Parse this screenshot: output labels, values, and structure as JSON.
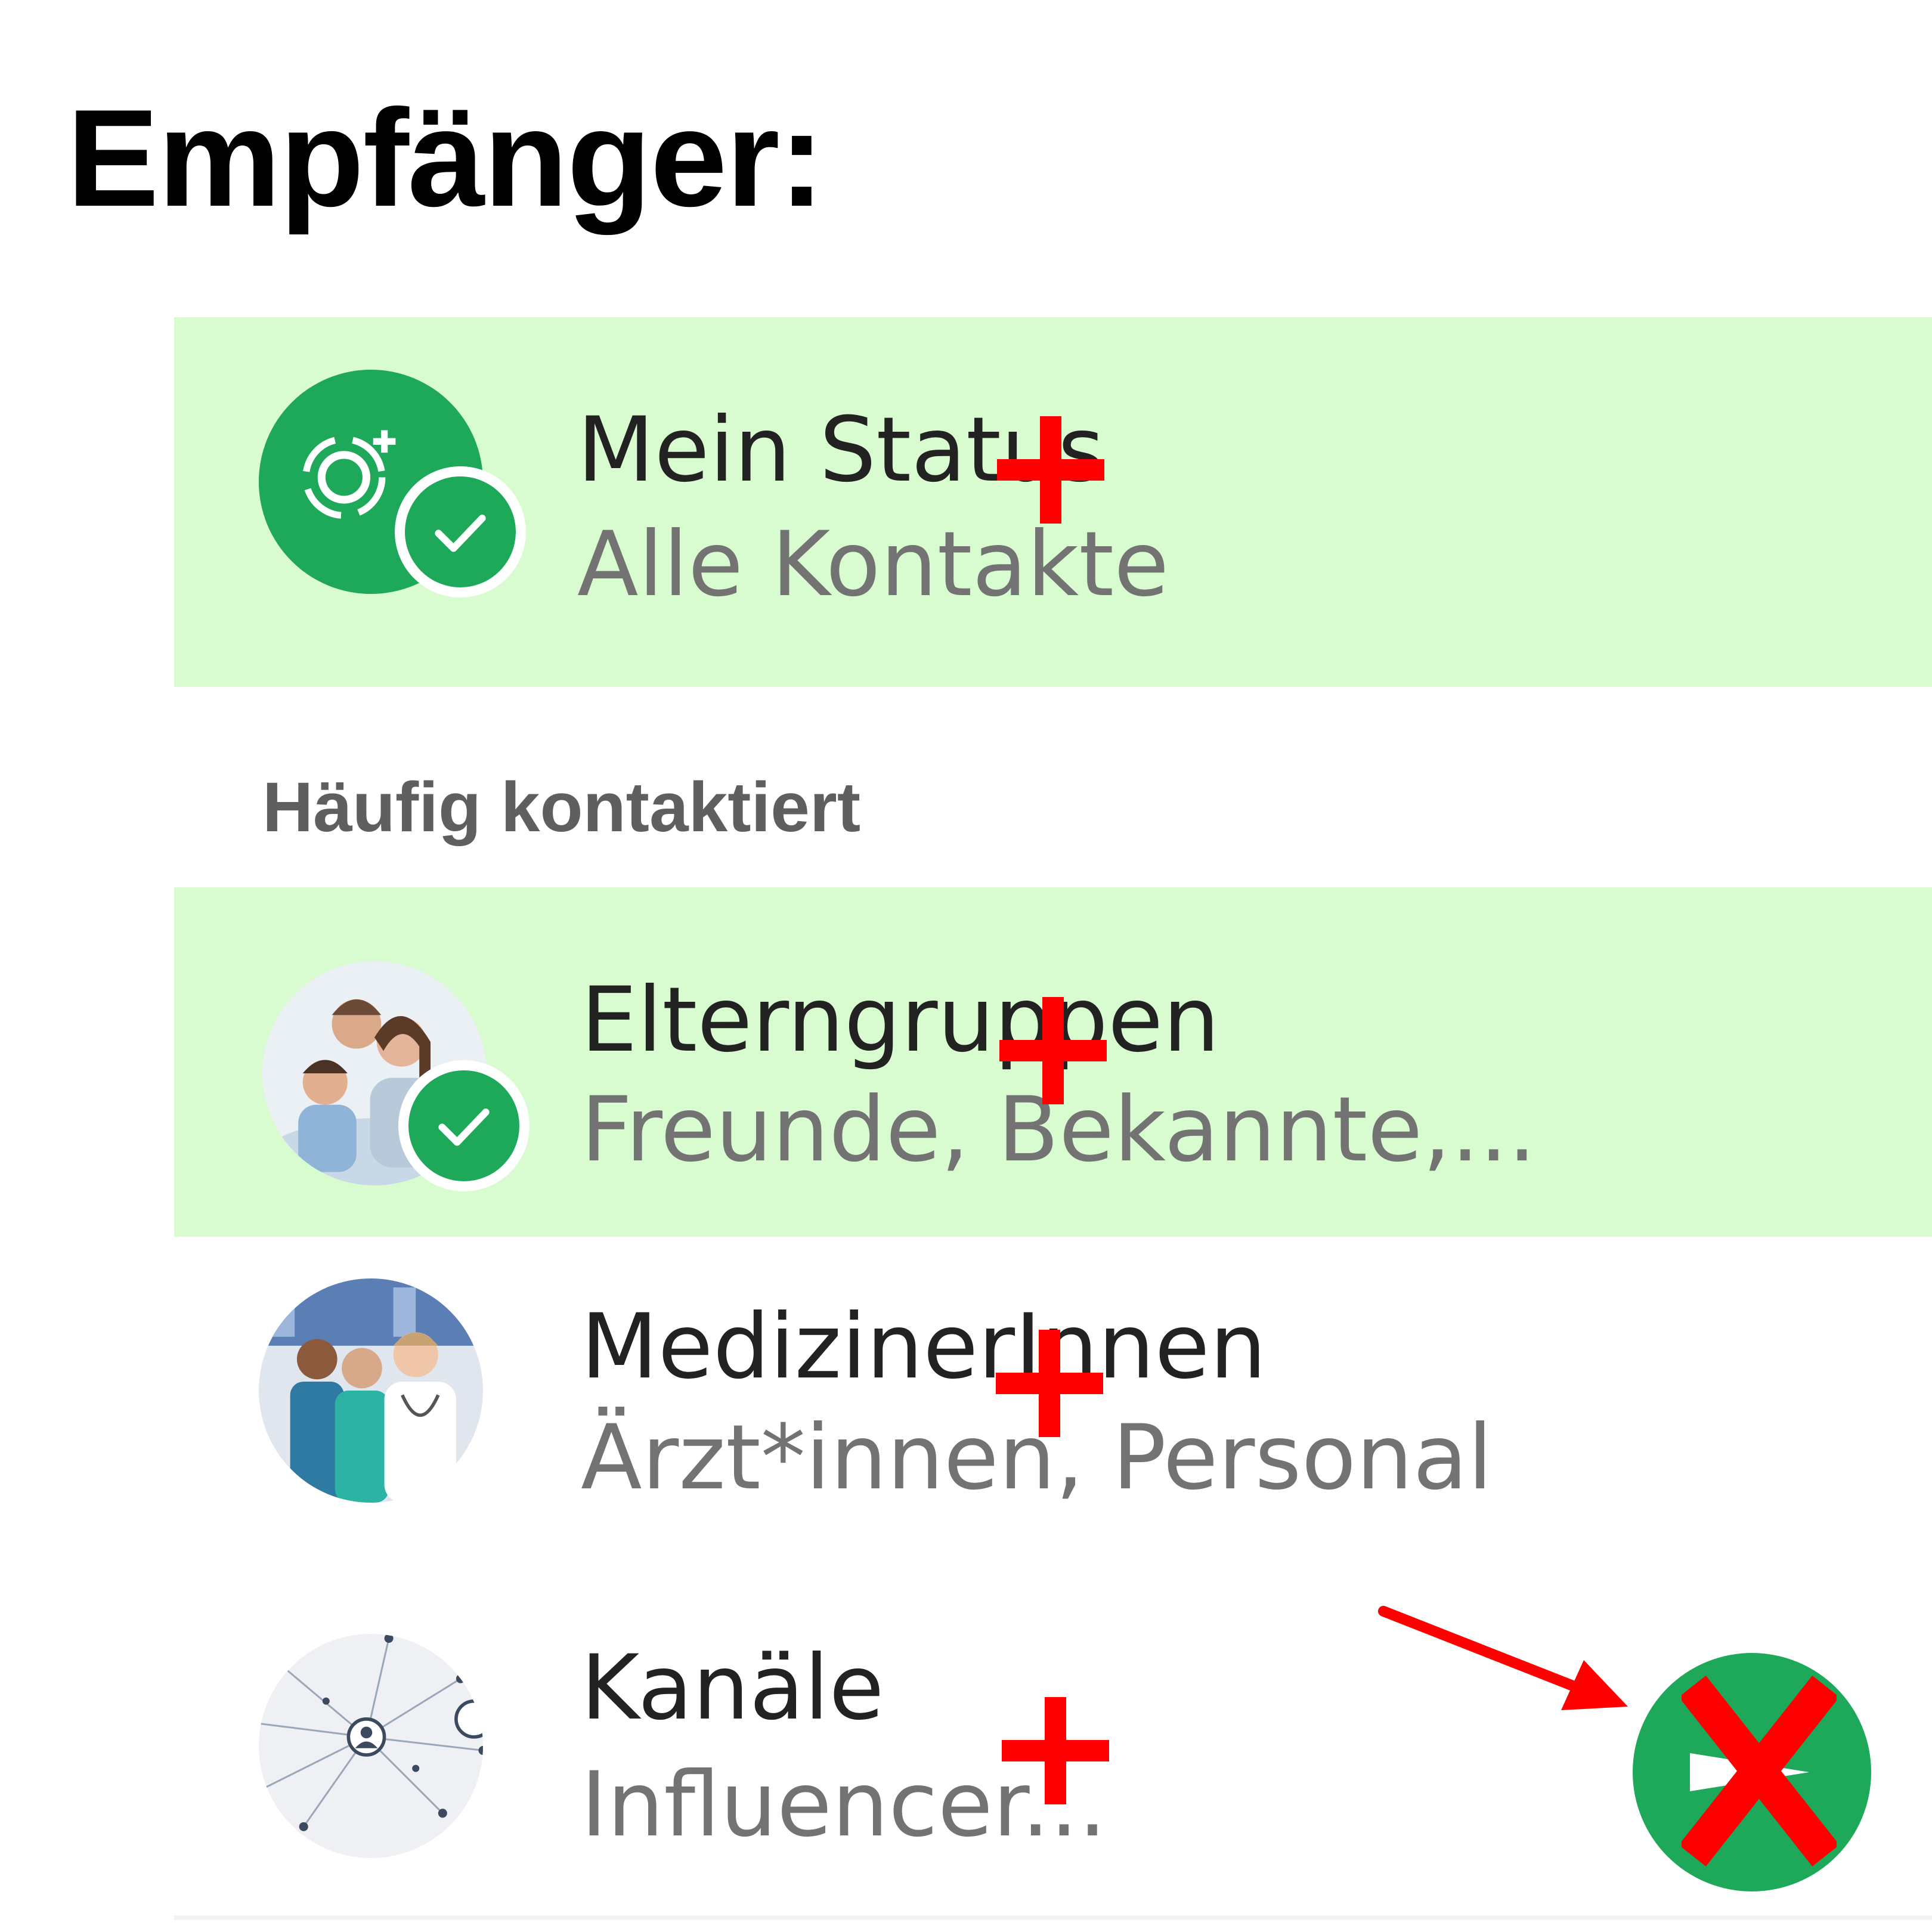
{
  "header": {
    "title": "Empfänger:"
  },
  "my_status": {
    "title": "Mein Status",
    "subtitle": "Alle Kontakte",
    "selected": true
  },
  "section": {
    "title": "Häufig kontaktiert"
  },
  "contacts": [
    {
      "title": "Elterngruppen",
      "subtitle": "Freunde, Bekannte,...",
      "selected": true,
      "avatar": "family-photo"
    },
    {
      "title": "MedizinerInnen",
      "subtitle": "Ärzt*innen, Personal",
      "selected": false,
      "avatar": "medical-staff-photo"
    },
    {
      "title": "Kanäle",
      "subtitle": "Influencer...",
      "selected": false,
      "avatar": "network-icon"
    }
  ],
  "fab": {
    "icon": "send-icon",
    "annotation": "red-x-mark"
  },
  "colors": {
    "accent": "#1ea85a",
    "selected_bg": "#d8fbd0",
    "annotation": "#ff0000"
  }
}
